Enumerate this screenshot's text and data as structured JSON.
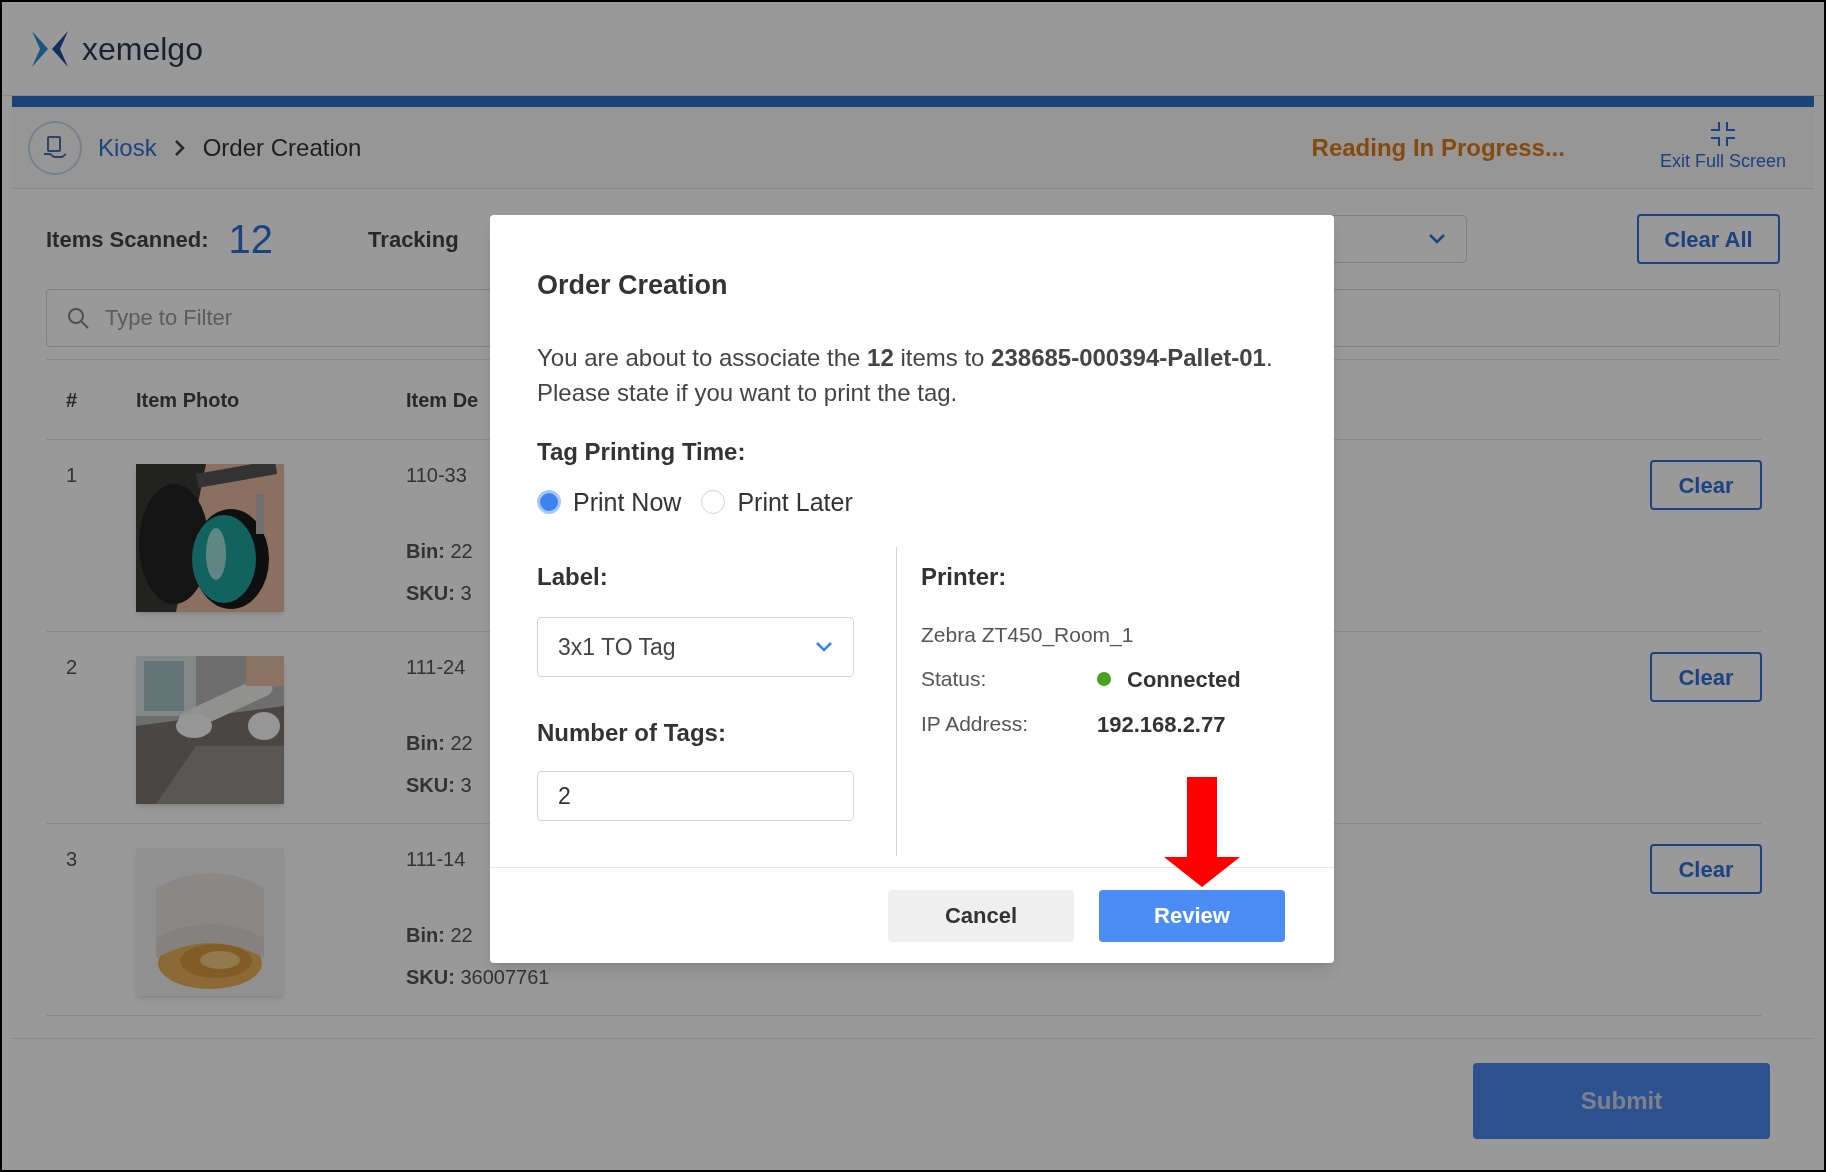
{
  "header": {
    "logo_text": "xemelgo"
  },
  "progress": {
    "level": 1
  },
  "breadcrumb": [
    {
      "label": "Kiosk",
      "kind": "link"
    },
    {
      "label": "Order Creation",
      "kind": "current"
    }
  ],
  "status_text": "Reading In Progress...",
  "exit_button": "Exit Full Screen",
  "summary": {
    "label": "Items Scanned:",
    "count": "12",
    "tracking_label": "Tracking"
  },
  "clear_all": "Clear All",
  "filter": {
    "placeholder": "Type to Filter"
  },
  "table": {
    "columns": [
      "#",
      "Item Photo",
      "Item De"
    ],
    "rows": [
      {
        "number": "1",
        "item": "110-33",
        "bin": "**Bin:** 22",
        "sku": "**SKU:** 3",
        "clear": "Clear"
      },
      {
        "number": "2",
        "item": "111-24",
        "bin": "**Bin:** 22",
        "sku": "**SKU:** 3",
        "clear": "Clear"
      },
      {
        "number": "3",
        "item": "111-14",
        "bin": "**Bin:** 22",
        "sku": "**SKU:** 36007761",
        "clear": "Clear"
      }
    ]
  },
  "submit": "Submit",
  "modal": {
    "title": "Order Creation",
    "message": "You are about to associate the **12** items to **238685-000394-Pallet-01**. Please state if you want to print the tag.",
    "time_label": "Tag Printing Time:",
    "time_options": [
      {
        "label": "Print Now",
        "selected": true
      },
      {
        "label": "Print Later",
        "selected": false
      }
    ],
    "label_label": "Label:",
    "label_value": "3x1 TO Tag",
    "tags_label": "Number of Tags:",
    "tags_value": "2",
    "printer_label": "Printer:",
    "printer_name": "Zebra ZT450_Room_1",
    "details": [
      {
        "key": "Status:",
        "value": "Connected",
        "kind": "status"
      },
      {
        "key": "IP Address:",
        "value": "192.168.2.77",
        "kind": "text"
      }
    ],
    "buttons": [
      {
        "label": "Cancel",
        "kind": "secondary"
      },
      {
        "label": "Review",
        "kind": "primary"
      }
    ]
  }
}
